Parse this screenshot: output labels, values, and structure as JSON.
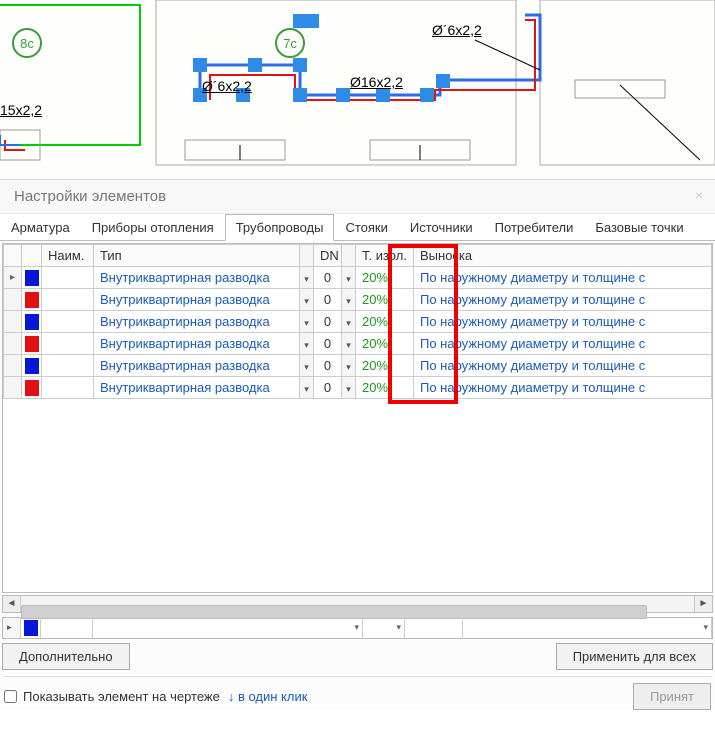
{
  "drawing": {
    "room_badges": [
      "8с",
      "7с"
    ],
    "pipe_labels": [
      "15x2,2",
      "Ø´6x2,2",
      "Ø16x2,2",
      "Ø´6x2,2"
    ]
  },
  "panel_title": "Настройки элементов",
  "tabs": [
    "Арматура",
    "Приборы отопления",
    "Трубопроводы",
    "Стояки",
    "Источники",
    "Потребители",
    "Базовые точки"
  ],
  "active_tab_index": 2,
  "columns": {
    "name": "Наим.",
    "type": "Тип",
    "dn": "DN",
    "iso": "Т. изол.",
    "callout": "Выноска"
  },
  "rows": [
    {
      "color": "blue",
      "type": "Внутриквартирная разводка",
      "dn": "0",
      "iso": "20%",
      "callout": "По наружному диаметру и толщине с"
    },
    {
      "color": "red",
      "type": "Внутриквартирная разводка",
      "dn": "0",
      "iso": "20%",
      "callout": "По наружному диаметру и толщине с"
    },
    {
      "color": "blue",
      "type": "Внутриквартирная разводка",
      "dn": "0",
      "iso": "20%",
      "callout": "По наружному диаметру и толщине с"
    },
    {
      "color": "red",
      "type": "Внутриквартирная разводка",
      "dn": "0",
      "iso": "20%",
      "callout": "По наружному диаметру и толщине с"
    },
    {
      "color": "blue",
      "type": "Внутриквартирная разводка",
      "dn": "0",
      "iso": "20%",
      "callout": "По наружному диаметру и толщине с"
    },
    {
      "color": "red",
      "type": "Внутриквартирная разводка",
      "dn": "0",
      "iso": "20%",
      "callout": "По наружному диаметру и толщине с"
    }
  ],
  "buttons": {
    "additional": "Дополнительно",
    "apply_all": "Применить для всех",
    "accept": "Принят"
  },
  "checkbox": {
    "label": "Показывать элемент на чертеже",
    "link": "↓ в один клик"
  }
}
